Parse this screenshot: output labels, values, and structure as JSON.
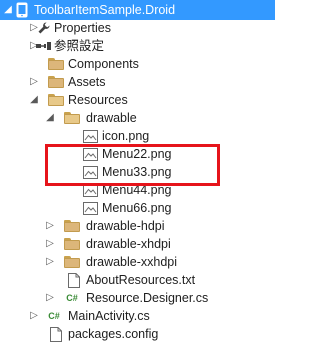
{
  "tree": {
    "root_label": "ToolbarItemSample.Droid",
    "properties_label": "Properties",
    "references_label": "参照設定",
    "components_label": "Components",
    "assets_label": "Assets",
    "resources_label": "Resources",
    "drawable_label": "drawable",
    "files_drawable": [
      "icon.png",
      "Menu22.png",
      "Menu33.png",
      "Menu44.png",
      "Menu66.png"
    ],
    "drawable_hdpi_label": "drawable-hdpi",
    "drawable_xhdpi_label": "drawable-xhdpi",
    "drawable_xxhdpi_label": "drawable-xxhdpi",
    "about_resources_label": "AboutResources.txt",
    "resource_designer_label": "Resource.Designer.cs",
    "main_activity_label": "MainActivity.cs",
    "packages_config_label": "packages.config",
    "cs_badge": "C#"
  },
  "colors": {
    "selection": "#3399ff",
    "highlight_border": "#e6141b",
    "folder": "#dcb67a",
    "csharp": "#388a34"
  }
}
